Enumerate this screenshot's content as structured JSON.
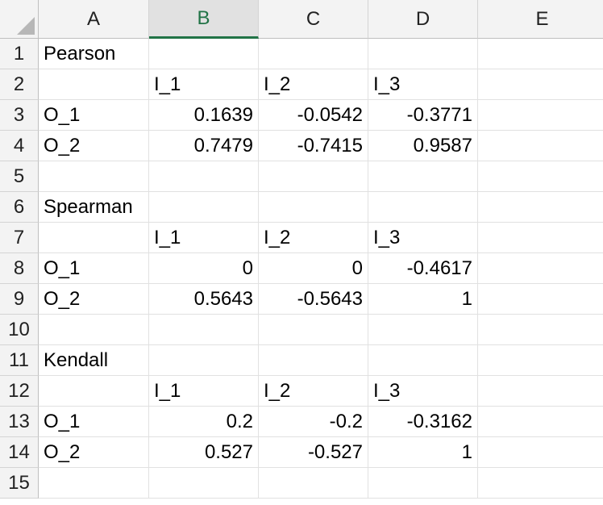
{
  "columns": [
    "A",
    "B",
    "C",
    "D",
    "E"
  ],
  "rows": [
    "1",
    "2",
    "3",
    "4",
    "5",
    "6",
    "7",
    "8",
    "9",
    "10",
    "11",
    "12",
    "13",
    "14",
    "15"
  ],
  "cells": [
    [
      "Pearson",
      "",
      "",
      "",
      ""
    ],
    [
      "",
      "I_1",
      "I_2",
      "I_3",
      ""
    ],
    [
      "O_1",
      "0.1639",
      "-0.0542",
      "-0.3771",
      ""
    ],
    [
      "O_2",
      "0.7479",
      "-0.7415",
      "0.9587",
      ""
    ],
    [
      "",
      "",
      "",
      "",
      ""
    ],
    [
      "Spearman",
      "",
      "",
      "",
      ""
    ],
    [
      "",
      "I_1",
      "I_2",
      "I_3",
      ""
    ],
    [
      "O_1",
      "0",
      "0",
      "-0.4617",
      ""
    ],
    [
      "O_2",
      "0.5643",
      "-0.5643",
      "1",
      ""
    ],
    [
      "",
      "",
      "",
      "",
      ""
    ],
    [
      "Kendall",
      "",
      "",
      "",
      ""
    ],
    [
      "",
      "I_1",
      "I_2",
      "I_3",
      ""
    ],
    [
      "O_1",
      "0.2",
      "-0.2",
      "-0.3162",
      ""
    ],
    [
      "O_2",
      "0.527",
      "-0.527",
      "1",
      ""
    ],
    [
      "",
      "",
      "",
      "",
      ""
    ]
  ],
  "active_column": "B",
  "accent_color": "#217346"
}
